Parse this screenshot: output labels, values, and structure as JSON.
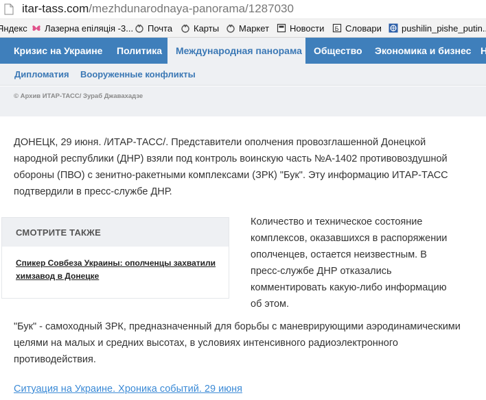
{
  "browser": {
    "url_host": "itar-tass.com",
    "url_path": "/mezhdunarodnaya-panorama/1287030",
    "bookmarks": [
      {
        "label": "Яндекс",
        "icon": "yandex-icon"
      },
      {
        "label": "Лазерна епіляція -3...",
        "icon": "butterfly-icon"
      },
      {
        "label": "Почта",
        "icon": "bookmark-yandex-icon"
      },
      {
        "label": "Карты",
        "icon": "bookmark-yandex-icon"
      },
      {
        "label": "Маркет",
        "icon": "bookmark-yandex-icon"
      },
      {
        "label": "Новости",
        "icon": "page-icon"
      },
      {
        "label": "Словари",
        "icon": "dictionary-icon"
      },
      {
        "label": "pushilin_pishe_putin...",
        "icon": "globe-icon"
      }
    ]
  },
  "nav": {
    "items": [
      "Кризис на Украине",
      "Политика",
      "Международная панорама",
      "Общество",
      "Экономика и бизнес",
      "Н"
    ],
    "active_index": 2
  },
  "subnav": {
    "items": [
      "Дипломатия",
      "Вооруженные конфликты"
    ]
  },
  "photo_credit": "© Архив ИТАР-ТАСС/ Зураб Джавахадзе",
  "article": {
    "p1": "ДОНЕЦК, 29 июня. /ИТАР-ТАСС/. Представители ополчения провозглашенной Донецкой народной республики (ДНР) взяли под контроль воинскую часть №А-1402 противовоздушной обороны (ПВО) с зенитно-ракетными комплексами (ЗРК) \"Бук\". Эту информацию ИТАР-ТАСС подтвердили в пресс-службе ДНР.",
    "p2": "Количество и техническое состояние комплексов, оказавшихся в распоряжении ополченцев, остается неизвестным. В пресс-службе ДНР отказались комментировать какую-либо информацию об этом.",
    "p3": "\"Бук\" - самоходный ЗРК, предназначенный для борьбы с маневрирующими аэродинамическими целями на малых и средних высотах, в условиях интенсивного радиоэлектронного противодействия.",
    "chronicle_link": "Ситуация на Украине. Хроника событий. 29 июня"
  },
  "see_also": {
    "heading": "СМОТРИТЕ ТАКЖЕ",
    "link": "Спикер Совбеза Украины: ополченцы захватили химзавод в Донецке"
  },
  "colors": {
    "nav_blue": "#3f7fbb",
    "link_blue": "#3b8ad6",
    "subnav_bg": "#eef0f3"
  }
}
